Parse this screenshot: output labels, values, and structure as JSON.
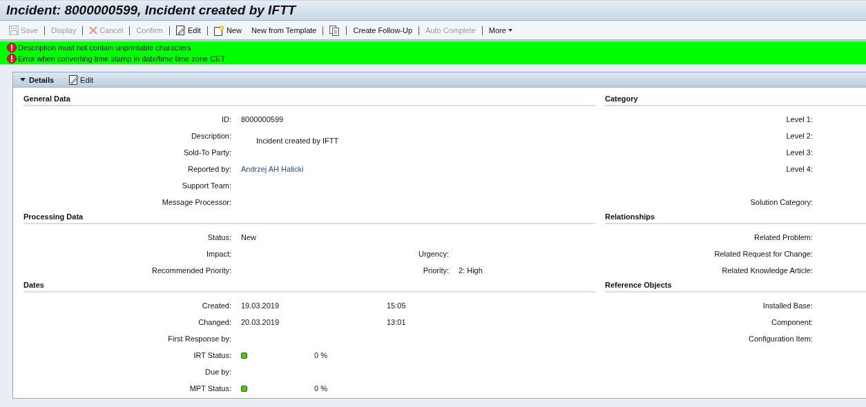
{
  "window": {
    "title": "Incident: 8000000599, Incident created by IFTT"
  },
  "toolbar": [
    {
      "kind": "save",
      "label": "Save",
      "disabled": true
    },
    {
      "kind": "separator"
    },
    {
      "kind": "plain",
      "label": "Display",
      "disabled": true
    },
    {
      "kind": "separator"
    },
    {
      "kind": "cancel",
      "label": "Cancel",
      "disabled": true
    },
    {
      "kind": "separator"
    },
    {
      "kind": "plain",
      "label": "Confirm",
      "disabled": true
    },
    {
      "kind": "separator"
    },
    {
      "kind": "edit",
      "label": "Edit",
      "disabled": false
    },
    {
      "kind": "separator"
    },
    {
      "kind": "new",
      "label": "New",
      "disabled": false
    },
    {
      "kind": "plain",
      "label": "New from Template",
      "disabled": false
    },
    {
      "kind": "separator"
    },
    {
      "kind": "copy"
    },
    {
      "kind": "separator"
    },
    {
      "kind": "plain",
      "label": "Create Follow-Up",
      "disabled": false
    },
    {
      "kind": "separator"
    },
    {
      "kind": "plain",
      "label": "Auto Complete",
      "disabled": true
    },
    {
      "kind": "separator"
    },
    {
      "kind": "menu",
      "label": "More",
      "disabled": false
    }
  ],
  "messages": [
    {
      "text": "Description must not contain unprintable characters"
    },
    {
      "text": "Error when converting time stamp in date/time time zone CET"
    }
  ],
  "details": {
    "title": "Details",
    "expanded": true,
    "edit_label": "Edit",
    "left_sections": [
      {
        "heading": "General Data",
        "rows": [
          {
            "kind": "field",
            "label": "ID:",
            "value": "8000000599"
          },
          {
            "kind": "textarea",
            "label": "Description:",
            "value": "Incident created by IFTT"
          },
          {
            "kind": "field",
            "label": "Sold-To Party:"
          },
          {
            "kind": "link",
            "label": "Reported by:",
            "value": "Andrzej AH Halicki"
          },
          {
            "kind": "field",
            "label": "Support Team:"
          },
          {
            "kind": "field",
            "label": "Message Processor:"
          }
        ]
      },
      {
        "heading": "Processing Data",
        "rows": [
          {
            "kind": "field",
            "label": "Status:",
            "value": "New"
          },
          {
            "kind": "pair",
            "label": "Impact:",
            "label_2": "Urgency:"
          },
          {
            "kind": "pair",
            "label": "Recommended Priority:",
            "label_2": "Priority:",
            "value_2": "2: High"
          }
        ]
      },
      {
        "heading": "Dates",
        "rows": [
          {
            "kind": "datetime",
            "label": "Created:",
            "date": "19.03.2019",
            "time": "15:05"
          },
          {
            "kind": "datetime",
            "label": "Changed:",
            "date": "20.03.2019",
            "time": "13:01"
          },
          {
            "kind": "field",
            "label": "First Response by:"
          },
          {
            "kind": "status",
            "label": "IRT Status:",
            "color": "#55c31f",
            "percent": "0 %"
          },
          {
            "kind": "field",
            "label": "Due by:"
          },
          {
            "kind": "status",
            "label": "MPT Status:",
            "color": "#55c31f",
            "percent": "0 %"
          }
        ]
      }
    ],
    "right_sections": [
      {
        "heading": "Category",
        "rows": [
          {
            "label": "Level 1:"
          },
          {
            "label": "Level 2:"
          },
          {
            "label": "Level 3:"
          },
          {
            "label": "Level 4:"
          },
          {
            "label": "Solution Category:",
            "spacer_before": true
          }
        ]
      },
      {
        "heading": "Relationships",
        "rows": [
          {
            "label": "Related Problem:"
          },
          {
            "label": "Related Request for Change:"
          },
          {
            "label": "Related Knowledge Article:"
          }
        ]
      },
      {
        "heading": "Reference Objects",
        "rows": [
          {
            "label": "Installed Base:"
          },
          {
            "label": "Component:"
          },
          {
            "label": "Configuration Item:"
          }
        ]
      }
    ]
  }
}
